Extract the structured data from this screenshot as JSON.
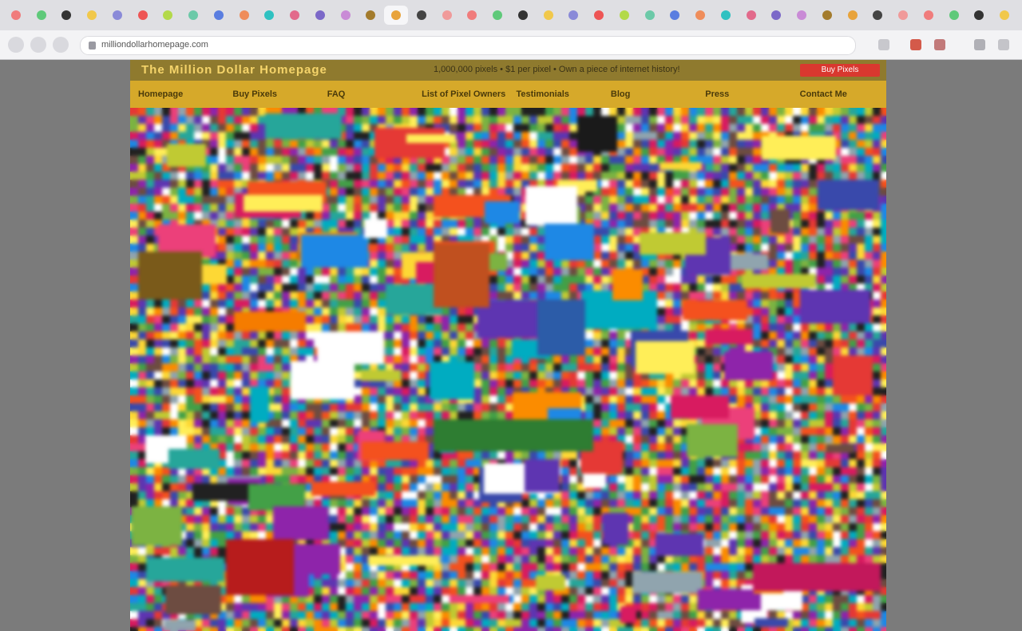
{
  "browser": {
    "tabs_count": 40,
    "active_tab_index": 15,
    "address": "milliondollarhomepage.com",
    "colors": {
      "chrome_bg": "#e9e9ec",
      "tabstrip_bg": "#dfdfe3"
    }
  },
  "page": {
    "title": "The Million Dollar Homepage",
    "stats": "1,000,000 pixels • $1 per pixel • Own a piece of internet history!",
    "header_button": "Buy Pixels",
    "menu": [
      "Homepage",
      "Buy Pixels",
      "FAQ",
      "List of Pixel Owners",
      "Testimonials",
      "Blog",
      "Press",
      "Contact Me"
    ],
    "colors": {
      "header_bg": "#8f7a2e",
      "menu_bg": "#d6a92a",
      "page_bg": "#7b7b7b"
    }
  }
}
